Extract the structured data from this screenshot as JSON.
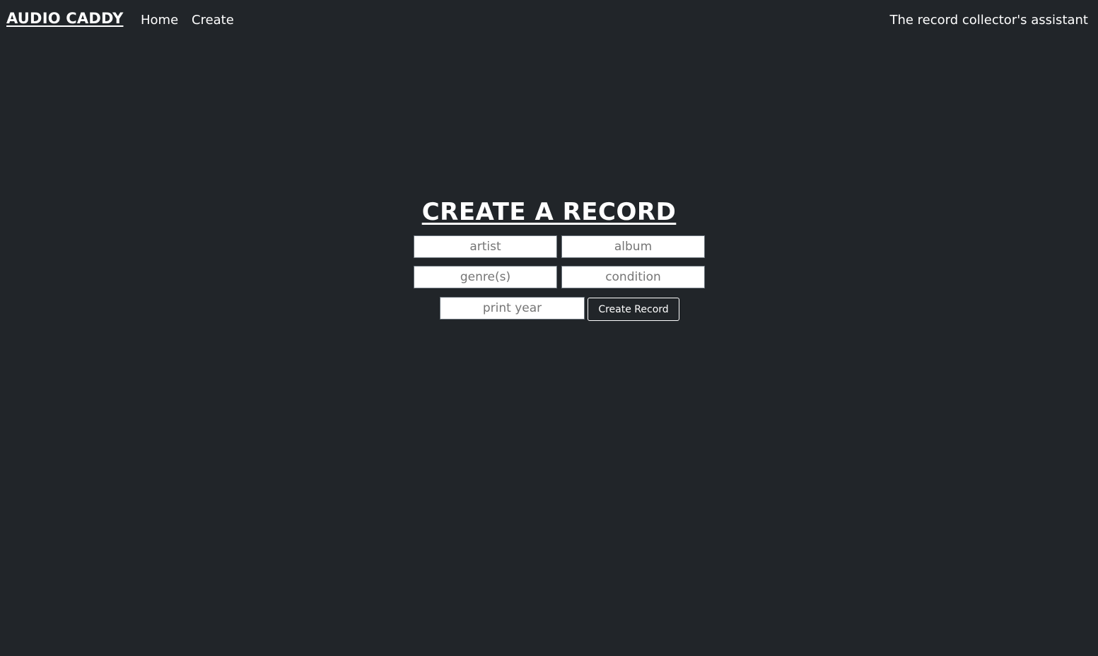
{
  "navbar": {
    "brand": "AUDIO CADDY",
    "links": [
      {
        "label": "Home"
      },
      {
        "label": "Create"
      }
    ],
    "tagline": "The record collector's assistant"
  },
  "form": {
    "title": "CREATE A RECORD",
    "fields": {
      "artist": {
        "placeholder": "artist",
        "value": ""
      },
      "album": {
        "placeholder": "album",
        "value": ""
      },
      "genre": {
        "placeholder": "genre(s)",
        "value": ""
      },
      "condition": {
        "placeholder": "condition",
        "value": ""
      },
      "print_year": {
        "placeholder": "print year",
        "value": ""
      }
    },
    "submit_label": "Create Record"
  },
  "colors": {
    "background": "#212529",
    "text": "#ffffff",
    "input_background": "#ffffff"
  }
}
